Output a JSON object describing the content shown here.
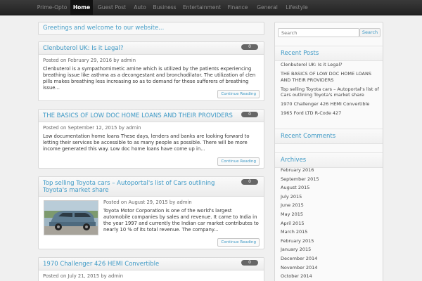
{
  "nav": {
    "items": [
      {
        "label": "Prime-Opto"
      },
      {
        "label": "Home",
        "active": true
      },
      {
        "label": "Guest Post"
      },
      {
        "label": "Auto"
      },
      {
        "label": "Business"
      },
      {
        "label": "Entertainment"
      },
      {
        "label": "Finance"
      },
      {
        "label": "General"
      },
      {
        "label": "Lifestyle"
      }
    ]
  },
  "welcome": "Greetings and welcome to our website...",
  "posts": [
    {
      "title": "Clenbuterol UK: Is it Legal?",
      "comments": "0",
      "meta": "Posted on February 29, 2016 by admin",
      "excerpt": "Clenbuterol is a sympathomimetic amine which is utilized by the patients experiencing breathing issue like asthma as a decongestant and bronchodilator. The utilization of clen pills makes breathing less increasing so as to demand for these sufferers of breathing issue...",
      "continue": "Continue Reading"
    },
    {
      "title": "THE BASICS OF LOW DOC HOME LOANS AND THEIR PROVIDERS",
      "comments": "0",
      "meta": "Posted on September 12, 2015 by admin",
      "excerpt": "Low documentation home loans These days, lenders and banks are looking forward to letting their services be accessible to as many people as possible. There will be more income generated this way. Low doc home loans have come up in...",
      "continue": "Continue Reading"
    },
    {
      "title": "Top selling Toyota cars – Autoportal's list of Cars outlining Toyota's market share",
      "comments": "0",
      "meta": "Posted on August 29, 2015 by admin",
      "excerpt": "Toyota Motor Corporation is one of the world's largest automobile companies by sales and revenue. It came to India in the year 1997 and currently the Indian car market contributes to nearly 10 % of its total revenue. The company...",
      "continue": "Continue Reading"
    },
    {
      "title": "1970 Challenger 426 HEMI Convertible",
      "comments": "0",
      "meta": "Posted on July 21, 2015 by admin"
    }
  ],
  "sidebar": {
    "search_placeholder": "Search",
    "search_button": "Search",
    "recent_posts_title": "Recent Posts",
    "recent_posts": [
      "Clenbuterol UK: Is it Legal?",
      "THE BASICS OF LOW DOC HOME LOANS AND THEIR PROVIDERS",
      "Top selling Toyota cars – Autoportal's list of Cars outlining Toyota's market share",
      "1970 Challenger 426 HEMI Convertible",
      "1965 Ford LTD R-Code 427"
    ],
    "recent_comments_title": "Recent Comments",
    "archives_title": "Archives",
    "archives": [
      "February 2016",
      "September 2015",
      "August 2015",
      "July 2015",
      "June 2015",
      "May 2015",
      "April 2015",
      "March 2015",
      "February 2015",
      "January 2015",
      "December 2014",
      "November 2014",
      "October 2014"
    ]
  },
  "colors": {
    "accent": "#3f9ac6",
    "nav_bg": "#2a2a2a",
    "page_bg": "#f0f0f0"
  }
}
